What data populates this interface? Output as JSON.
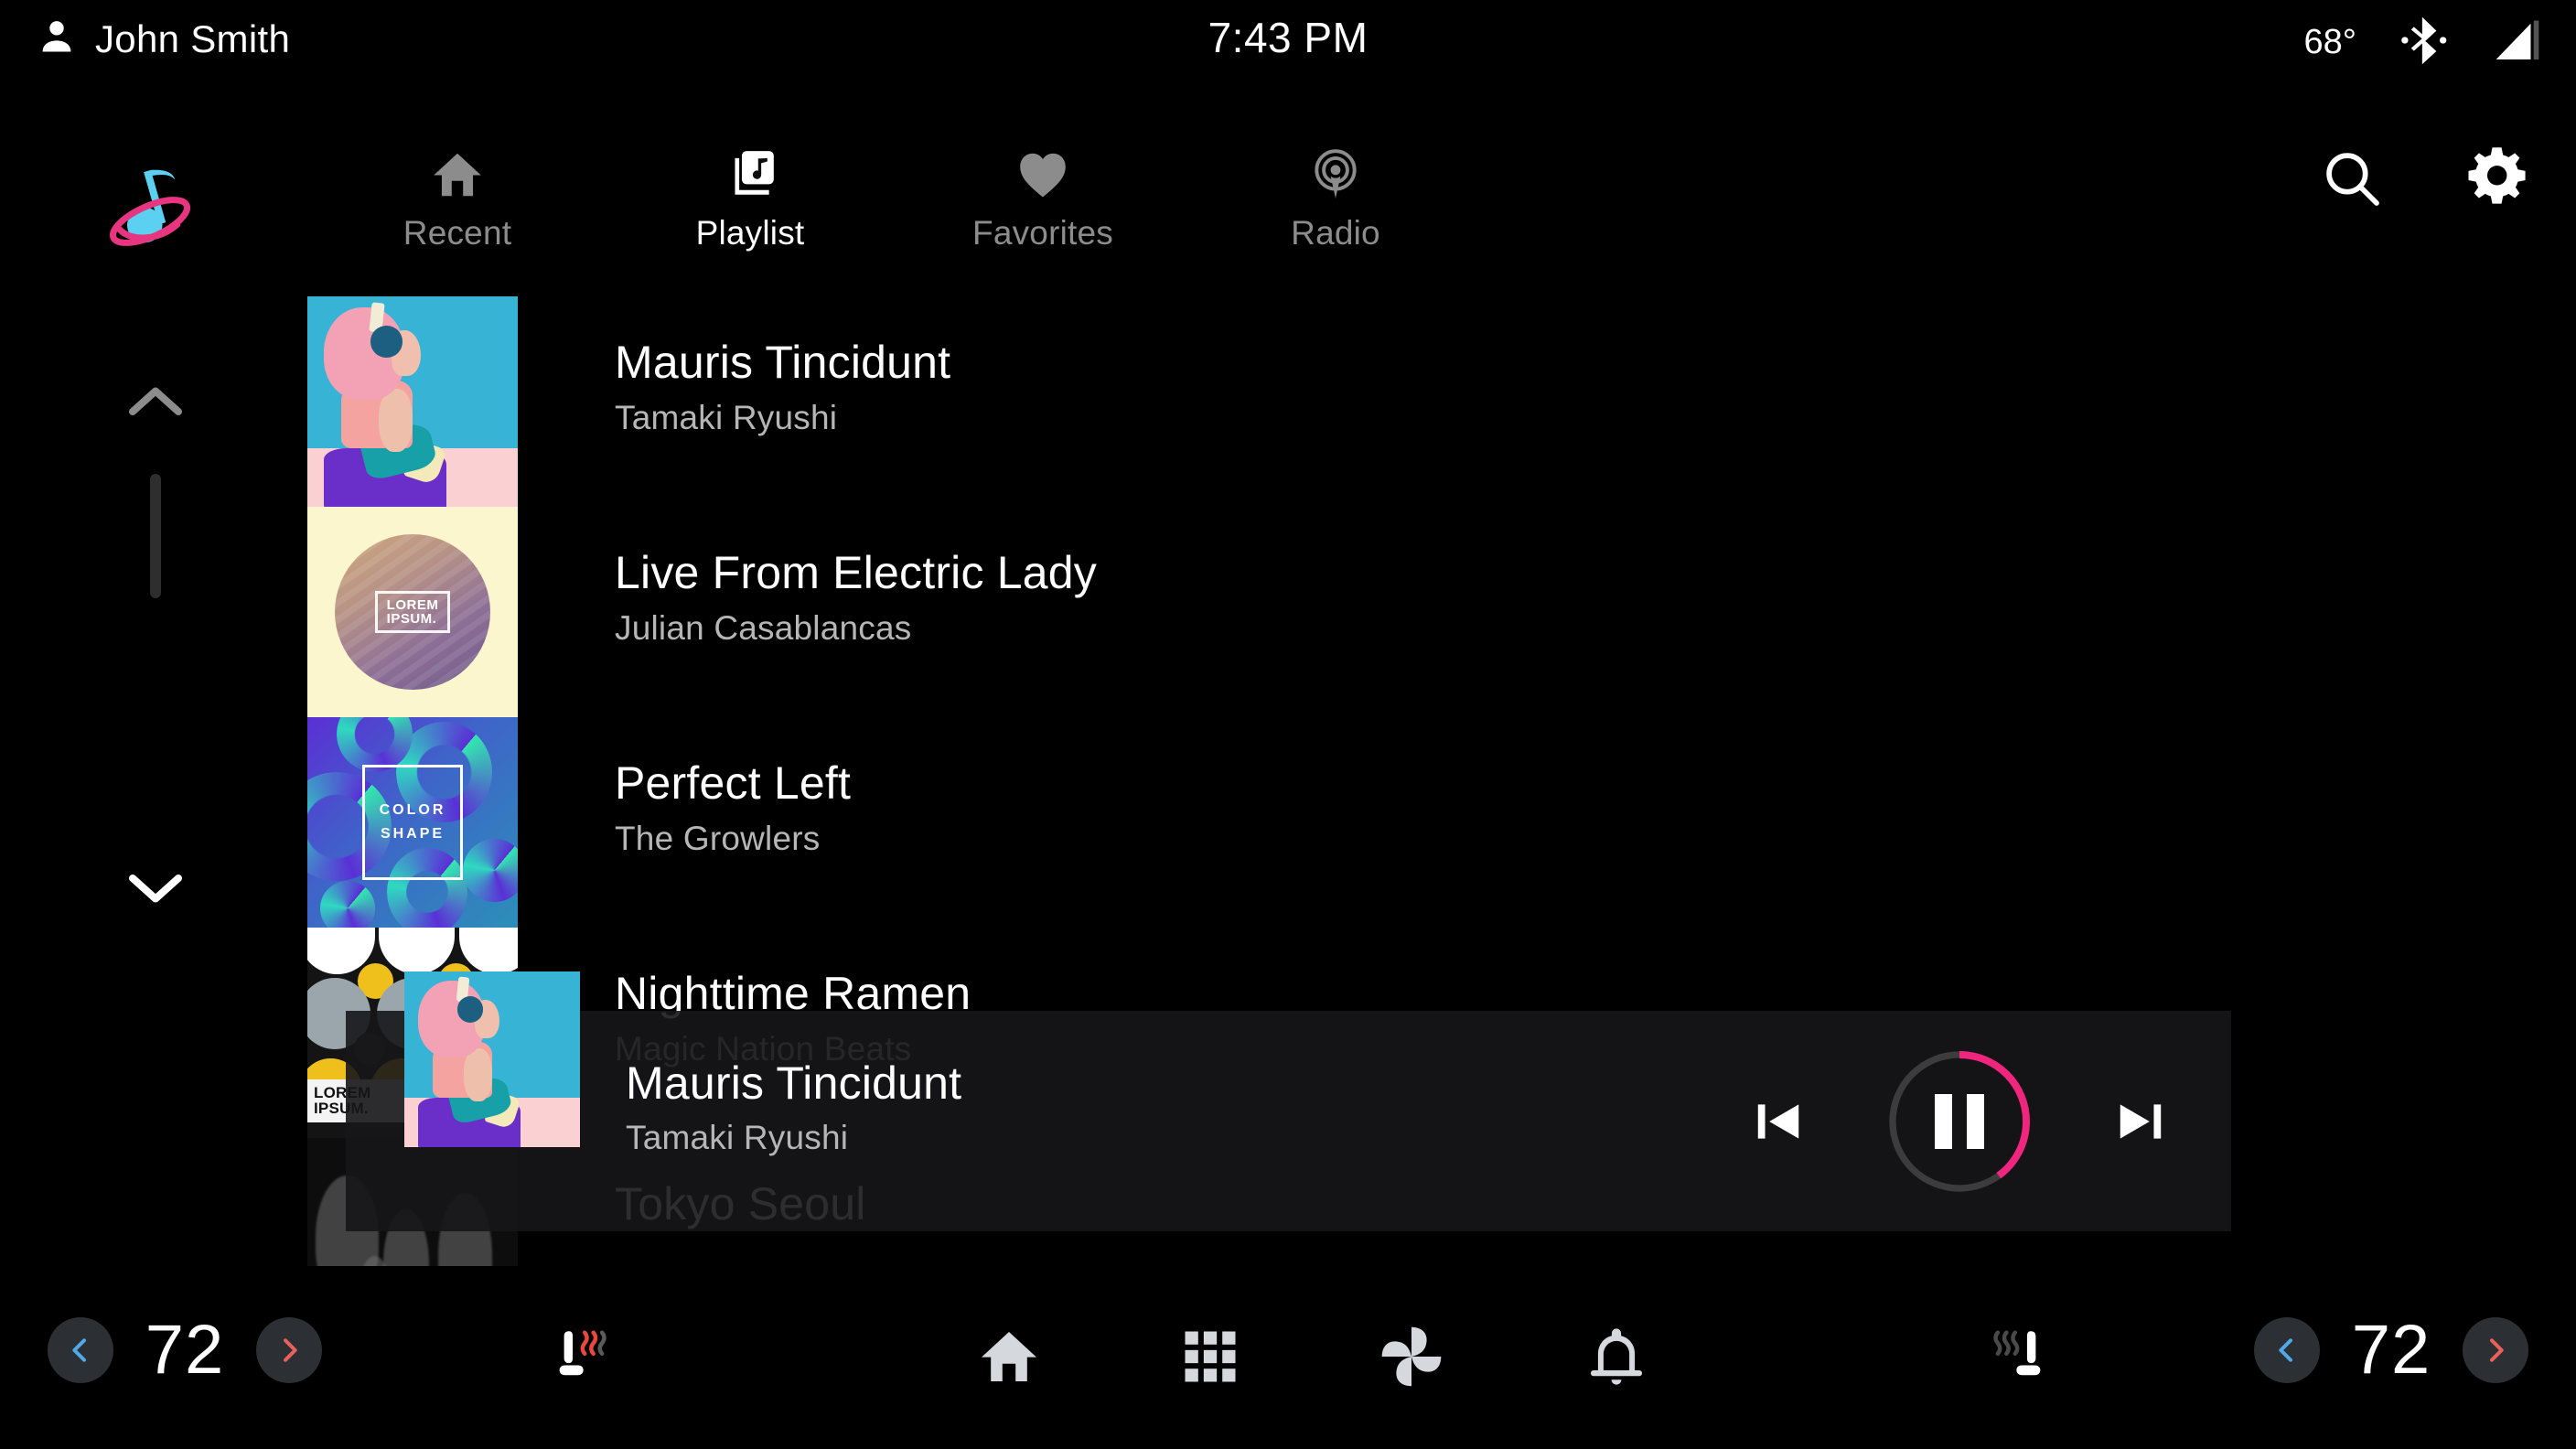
{
  "status_bar": {
    "user_icon": "person-icon",
    "user_name": "John Smith",
    "time": "7:43 PM",
    "outside_temp": "68°",
    "bluetooth_icon": "bluetooth-icon",
    "signal_icon": "cellular-signal-icon"
  },
  "header": {
    "app_logo": "music-note-planet-logo",
    "tabs": [
      {
        "label": "Recent",
        "icon": "home-icon",
        "active": false
      },
      {
        "label": "Playlist",
        "icon": "music-library-icon",
        "active": true
      },
      {
        "label": "Favorites",
        "icon": "heart-icon",
        "active": false
      },
      {
        "label": "Radio",
        "icon": "radio-waves-icon",
        "active": false
      }
    ],
    "search_icon": "search-icon",
    "settings_icon": "gear-icon"
  },
  "scroll": {
    "up_icon": "chevron-up-icon",
    "down_icon": "chevron-down-icon"
  },
  "track_list": [
    {
      "title": "Mauris Tincidunt",
      "artist": "Tamaki Ryushi",
      "art": "pinkhair"
    },
    {
      "title": "Live From Electric Lady",
      "artist": "Julian Casablancas",
      "art": "sphere",
      "art_label": "LOREM\nIPSUM."
    },
    {
      "title": "Perfect Left",
      "artist": "The Growlers",
      "art": "colorshape",
      "art_label": "COLOR\nSHAPE"
    },
    {
      "title": "Nighttime Ramen",
      "artist": "Magic Nation Beats",
      "art": "shapes",
      "art_label": "LOREM\nIPSUM."
    },
    {
      "title": "Tokyo Seoul",
      "artist": "",
      "art": "crowd"
    }
  ],
  "now_playing": {
    "title": "Mauris Tincidunt",
    "artist": "Tamaki Ryushi",
    "art": "pinkhair",
    "previous_icon": "skip-previous-icon",
    "play_pause_icon": "pause-icon",
    "next_icon": "skip-next-icon",
    "progress_percent": 40,
    "progress_color": "#F0257E",
    "track_color": "#3c3c3c"
  },
  "climate": {
    "left": {
      "decrease_icon": "chevron-left-icon",
      "value": "72",
      "increase_icon": "chevron-right-icon"
    },
    "right": {
      "decrease_icon": "chevron-left-icon",
      "value": "72",
      "increase_icon": "chevron-right-icon"
    },
    "decrease_color": "#4FA8E8",
    "increase_color": "#E8615A"
  },
  "bottom_icons": [
    {
      "name": "seat-heater-left-icon",
      "active": true
    },
    {
      "name": "home-icon",
      "active": false
    },
    {
      "name": "apps-grid-icon",
      "active": false
    },
    {
      "name": "fan-icon",
      "active": false
    },
    {
      "name": "bell-icon",
      "active": false
    },
    {
      "name": "seat-heater-right-icon",
      "active": false
    }
  ],
  "colors": {
    "background": "#000000",
    "accent_pink": "#F0257E",
    "logo_cyan": "#5BD0F0",
    "icon_grey": "#8c8c8c",
    "icon_light": "#D5D9DD"
  }
}
